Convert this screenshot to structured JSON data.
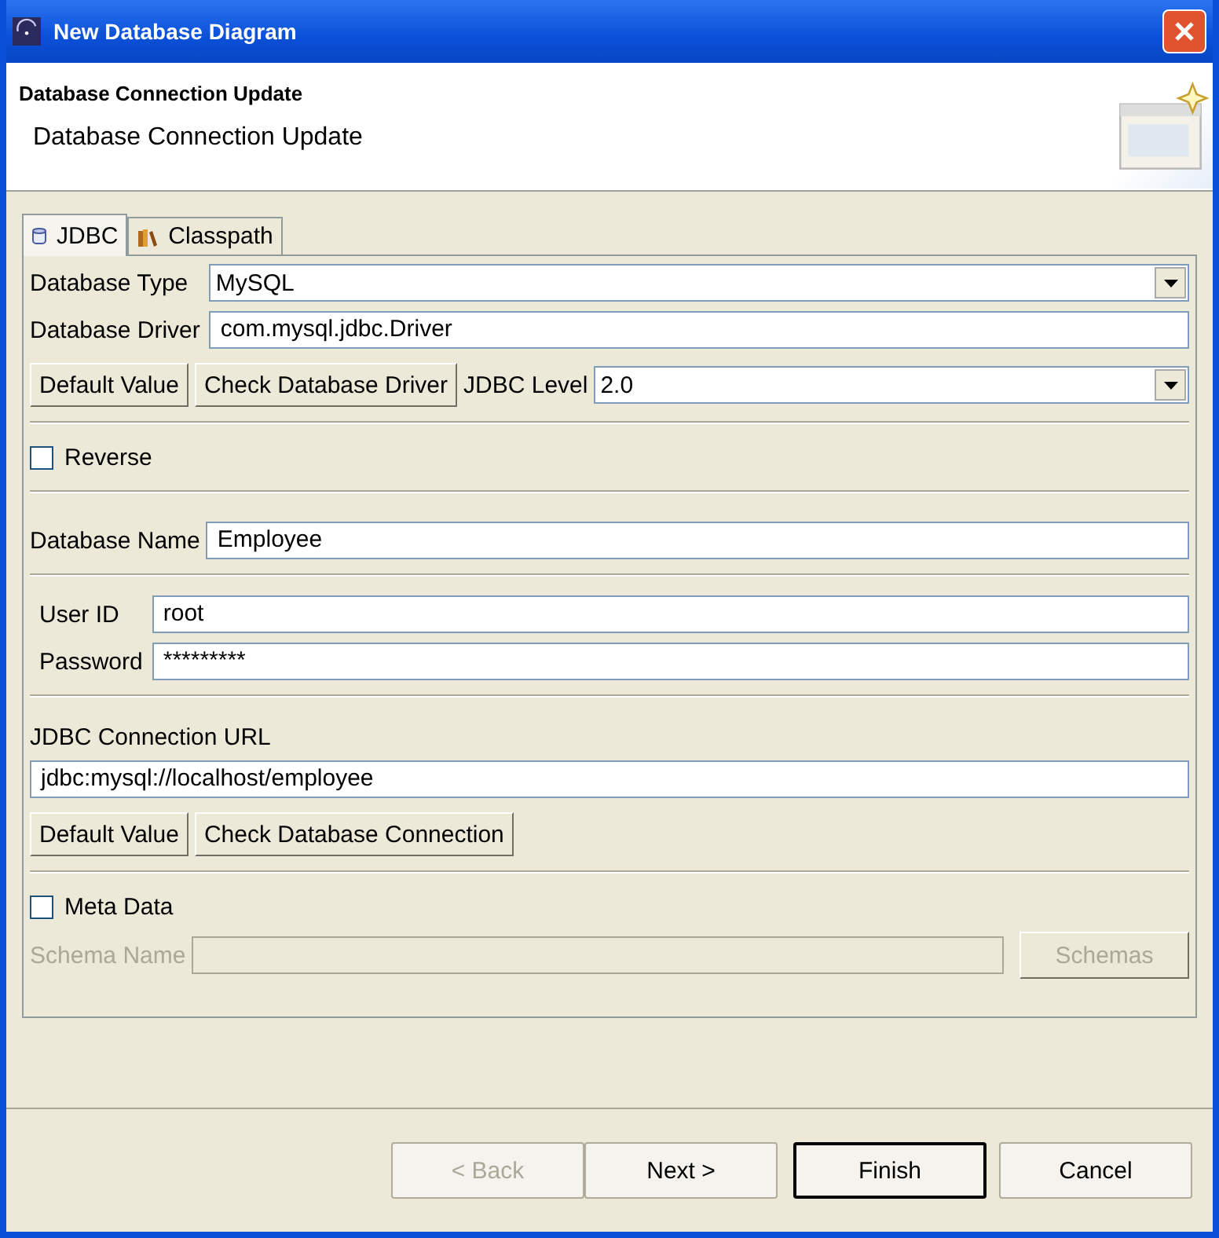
{
  "window": {
    "title": "New Database Diagram"
  },
  "header": {
    "title": "Database Connection Update",
    "message": "Database Connection Update"
  },
  "tabs": [
    {
      "label": "JDBC",
      "kind": "database",
      "selected": true
    },
    {
      "label": "Classpath",
      "kind": "library",
      "selected": false
    }
  ],
  "driver": {
    "type_label": "Database Type",
    "type_value": "MySQL",
    "driver_label": "Database Driver",
    "driver_value": "com.mysql.jdbc.Driver",
    "default_button": "Default Value",
    "check_button": "Check Database Driver",
    "level_label": "JDBC Level",
    "level_value": "2.0"
  },
  "reverse": {
    "label": "Reverse",
    "checked": false
  },
  "database_name": {
    "label": "Database Name",
    "value": "Employee"
  },
  "user_id": {
    "label": "User ID",
    "value": "root"
  },
  "password": {
    "label": "Password",
    "value": "*********"
  },
  "url": {
    "label": "JDBC Connection URL",
    "value": "jdbc:mysql://localhost/employee",
    "default_button": "Default Value",
    "check_button": "Check Database Connection"
  },
  "meta_data": {
    "label": "Meta Data",
    "checked": false
  },
  "schema": {
    "label": "Schema Name",
    "button": "Schemas",
    "disabled": true
  },
  "buttons": [
    {
      "label": "< Back",
      "disabled": true,
      "default": false
    },
    {
      "label": "Next >",
      "disabled": false,
      "default": false
    },
    {
      "label": "Finish",
      "disabled": false,
      "default": true
    },
    {
      "label": "Cancel",
      "disabled": false,
      "default": false
    }
  ]
}
